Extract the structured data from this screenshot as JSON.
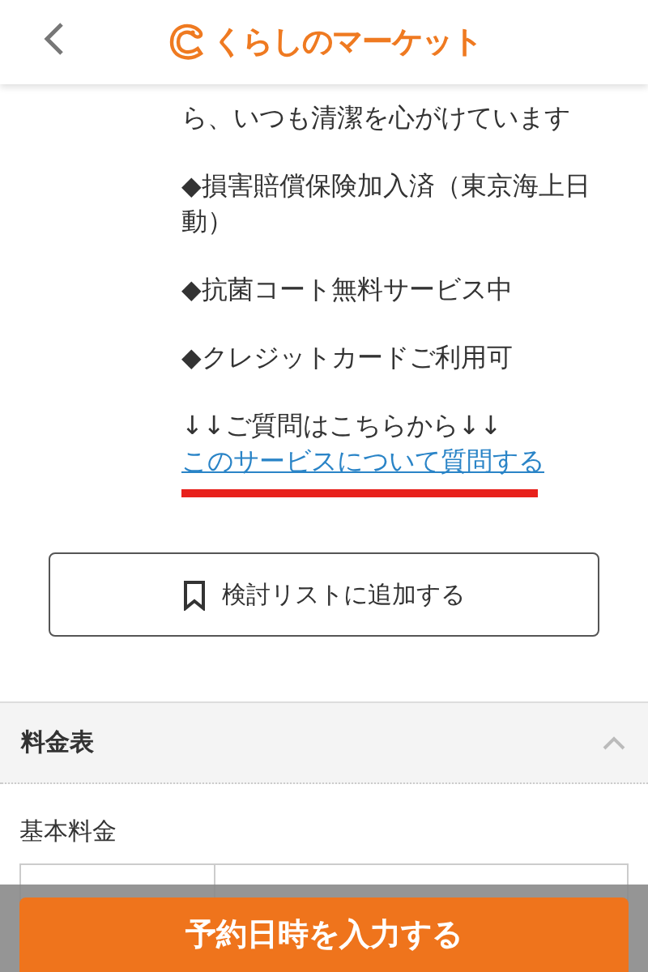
{
  "header": {
    "logo_text": "くらしのマーケット"
  },
  "description": [
    "ら、いつも清潔を心がけています",
    "◆損害賠償保険加入済（東京海上日動）",
    "◆抗菌コート無料サービス中",
    "◆クレジットカードご利用可"
  ],
  "question": {
    "lead": "↓↓ご質問はこちらから↓↓",
    "link": "このサービスについて質問する"
  },
  "wishlist_button": "検討リストに追加する",
  "price_section": {
    "title": "料金表",
    "expanded": true,
    "subtitle": "基本料金"
  },
  "cta_button": "予約日時を入力する"
}
